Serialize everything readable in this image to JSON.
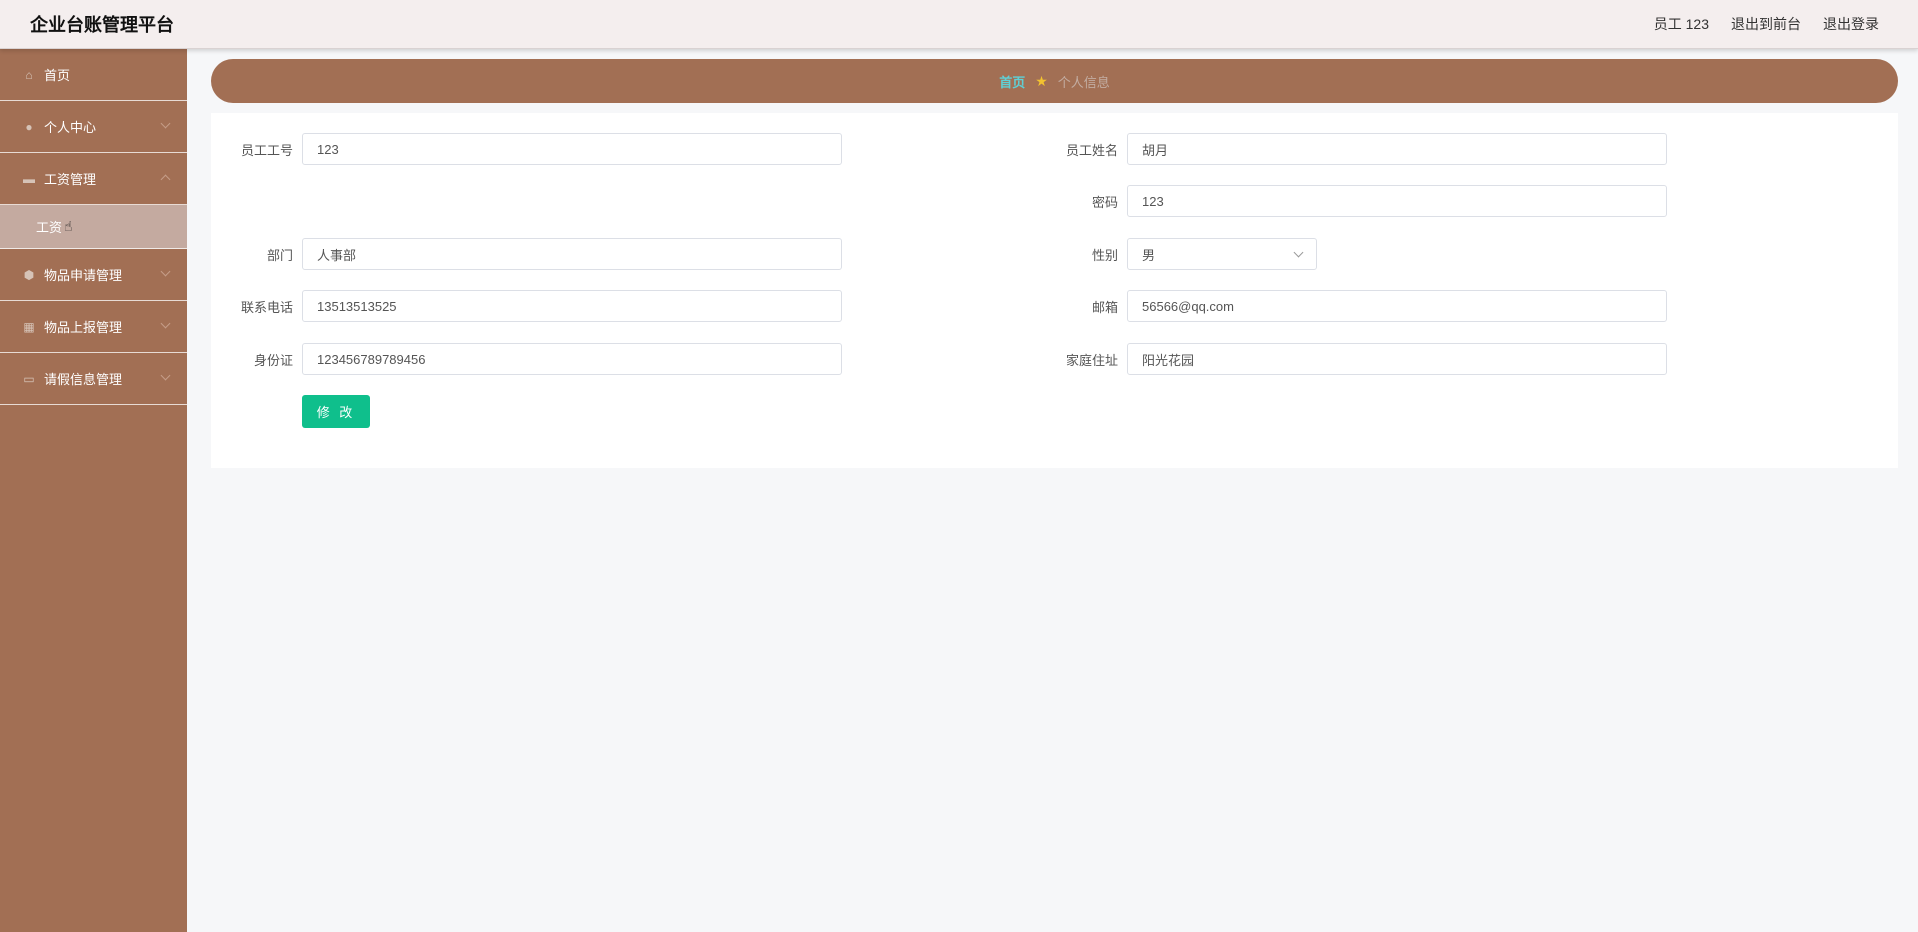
{
  "header": {
    "title": "企业台账管理平台",
    "user_label": "员工 123",
    "to_frontend": "退出到前台",
    "logout": "退出登录"
  },
  "sidebar": {
    "items": [
      {
        "label": "首页",
        "icon": "home-icon"
      },
      {
        "label": "个人中心",
        "icon": "user-icon"
      },
      {
        "label": "工资管理",
        "icon": "message-icon"
      },
      {
        "label": "工资",
        "icon": "",
        "active": true
      },
      {
        "label": "物品申请管理",
        "icon": "shield-icon"
      },
      {
        "label": "物品上报管理",
        "icon": "grid-icon"
      },
      {
        "label": "请假信息管理",
        "icon": "card-icon"
      }
    ]
  },
  "breadcrumb": {
    "home": "首页",
    "current": "个人信息",
    "separator_color": "#f2c230"
  },
  "form": {
    "emp_no_label": "员工工号",
    "emp_no": "123",
    "emp_name_label": "员工姓名",
    "emp_name": "胡月",
    "password_label": "密码",
    "password": "123",
    "dept_label": "部门",
    "dept": "人事部",
    "gender_label": "性别",
    "gender": "男",
    "phone_label": "联系电话",
    "phone": "13513513525",
    "email_label": "邮箱",
    "email": "56566@qq.com",
    "id_label": "身份证",
    "id_card": "123456789789456",
    "address_label": "家庭住址",
    "address": "阳光花园",
    "submit_label": "修 改"
  },
  "colors": {
    "sidebar": "#a26f54",
    "accent_button": "#0fbf8c",
    "breadcrumb_home": "#5fd0d6"
  }
}
